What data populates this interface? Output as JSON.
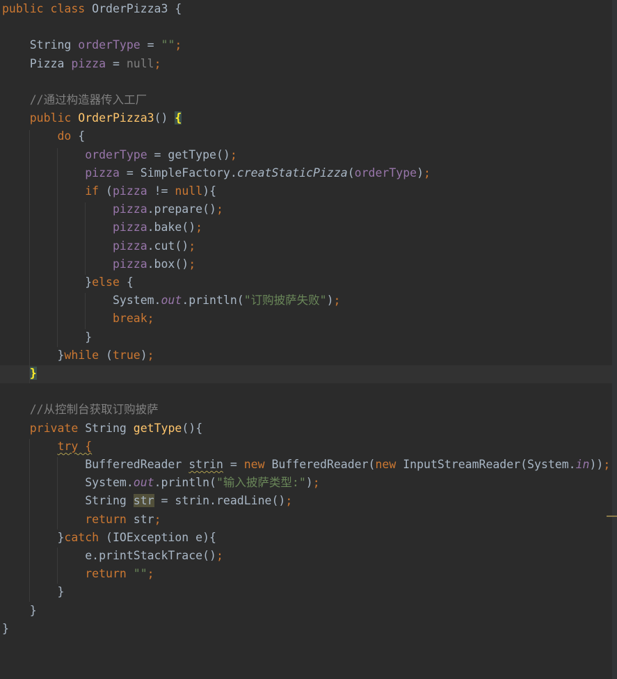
{
  "editor": {
    "language": "java",
    "caret_line": 21,
    "lines": [
      {
        "indent": "",
        "tokens": [
          {
            "t": "public class ",
            "c": "kw"
          },
          {
            "t": "OrderPizza3 {",
            "c": ""
          }
        ]
      },
      {
        "indent": "",
        "tokens": []
      },
      {
        "indent": "    ",
        "tokens": [
          {
            "t": "String ",
            "c": ""
          },
          {
            "t": "orderType",
            "c": "fld"
          },
          {
            "t": " = ",
            "c": ""
          },
          {
            "t": "\"\"",
            "c": "str"
          },
          {
            "t": ";",
            "c": "kw"
          }
        ]
      },
      {
        "indent": "    ",
        "tokens": [
          {
            "t": "Pizza ",
            "c": ""
          },
          {
            "t": "pizza",
            "c": "fld"
          },
          {
            "t": " = ",
            "c": ""
          },
          {
            "t": "null",
            "c": "nul"
          },
          {
            "t": ";",
            "c": "kw"
          }
        ]
      },
      {
        "indent": "",
        "tokens": []
      },
      {
        "indent": "    ",
        "tokens": [
          {
            "t": "//通过构造器传入工厂",
            "c": "cmt"
          }
        ]
      },
      {
        "indent": "    ",
        "tokens": [
          {
            "t": "public ",
            "c": "kw"
          },
          {
            "t": "OrderPizza3",
            "c": "fn"
          },
          {
            "t": "() ",
            "c": ""
          },
          {
            "t": "{",
            "c": "brace-hl"
          }
        ]
      },
      {
        "indent": "        ",
        "tokens": [
          {
            "t": "do ",
            "c": "kw"
          },
          {
            "t": "{",
            "c": ""
          }
        ]
      },
      {
        "indent": "            ",
        "tokens": [
          {
            "t": "orderType",
            "c": "fld"
          },
          {
            "t": " = getType()",
            "c": ""
          },
          {
            "t": ";",
            "c": "kw"
          }
        ]
      },
      {
        "indent": "            ",
        "tokens": [
          {
            "t": "pizza",
            "c": "fld"
          },
          {
            "t": " = SimpleFactory.",
            "c": ""
          },
          {
            "t": "creatStaticPizza",
            "c": "it"
          },
          {
            "t": "(",
            "c": ""
          },
          {
            "t": "orderType",
            "c": "fld"
          },
          {
            "t": ")",
            "c": ""
          },
          {
            "t": ";",
            "c": "kw"
          }
        ]
      },
      {
        "indent": "            ",
        "tokens": [
          {
            "t": "if ",
            "c": "kw"
          },
          {
            "t": "(",
            "c": ""
          },
          {
            "t": "pizza",
            "c": "fld"
          },
          {
            "t": " != ",
            "c": ""
          },
          {
            "t": "null",
            "c": "kw"
          },
          {
            "t": "){",
            "c": ""
          }
        ]
      },
      {
        "indent": "                ",
        "tokens": [
          {
            "t": "pizza",
            "c": "fld"
          },
          {
            "t": ".prepare()",
            "c": ""
          },
          {
            "t": ";",
            "c": "kw"
          }
        ]
      },
      {
        "indent": "                ",
        "tokens": [
          {
            "t": "pizza",
            "c": "fld"
          },
          {
            "t": ".bake()",
            "c": ""
          },
          {
            "t": ";",
            "c": "kw"
          }
        ]
      },
      {
        "indent": "                ",
        "tokens": [
          {
            "t": "pizza",
            "c": "fld"
          },
          {
            "t": ".cut()",
            "c": ""
          },
          {
            "t": ";",
            "c": "kw"
          }
        ]
      },
      {
        "indent": "                ",
        "tokens": [
          {
            "t": "pizza",
            "c": "fld"
          },
          {
            "t": ".box()",
            "c": ""
          },
          {
            "t": ";",
            "c": "kw"
          }
        ]
      },
      {
        "indent": "            ",
        "tokens": [
          {
            "t": "}",
            "c": ""
          },
          {
            "t": "else ",
            "c": "kw"
          },
          {
            "t": "{",
            "c": ""
          }
        ]
      },
      {
        "indent": "                ",
        "tokens": [
          {
            "t": "System.",
            "c": ""
          },
          {
            "t": "out",
            "c": "fld it"
          },
          {
            "t": ".println(",
            "c": ""
          },
          {
            "t": "\"订购披萨失败\"",
            "c": "str"
          },
          {
            "t": ")",
            "c": ""
          },
          {
            "t": ";",
            "c": "kw"
          }
        ]
      },
      {
        "indent": "                ",
        "tokens": [
          {
            "t": "break;",
            "c": "kw"
          }
        ]
      },
      {
        "indent": "            ",
        "tokens": [
          {
            "t": "}",
            "c": ""
          }
        ]
      },
      {
        "indent": "        ",
        "tokens": [
          {
            "t": "}",
            "c": ""
          },
          {
            "t": "while ",
            "c": "kw"
          },
          {
            "t": "(",
            "c": ""
          },
          {
            "t": "true",
            "c": "kw"
          },
          {
            "t": ")",
            "c": ""
          },
          {
            "t": ";",
            "c": "kw"
          }
        ]
      },
      {
        "indent": "    ",
        "tokens": [
          {
            "t": "}",
            "c": "brace-hl"
          }
        ]
      },
      {
        "indent": "",
        "tokens": []
      },
      {
        "indent": "    ",
        "tokens": [
          {
            "t": "//从控制台获取订购披萨",
            "c": "cmt"
          }
        ]
      },
      {
        "indent": "    ",
        "tokens": [
          {
            "t": "private ",
            "c": "kw"
          },
          {
            "t": "String ",
            "c": ""
          },
          {
            "t": "getType",
            "c": "fn"
          },
          {
            "t": "(){",
            "c": ""
          }
        ]
      },
      {
        "indent": "        ",
        "tokens": [
          {
            "t": "try {",
            "c": "kw warn"
          }
        ]
      },
      {
        "indent": "            ",
        "tokens": [
          {
            "t": "BufferedReader ",
            "c": ""
          },
          {
            "t": "strin",
            "c": "warn"
          },
          {
            "t": " = ",
            "c": ""
          },
          {
            "t": "new ",
            "c": "kw"
          },
          {
            "t": "BufferedReader(",
            "c": ""
          },
          {
            "t": "new ",
            "c": "kw"
          },
          {
            "t": "InputStreamReader(System.",
            "c": ""
          },
          {
            "t": "in",
            "c": "fld it"
          },
          {
            "t": "))",
            "c": ""
          },
          {
            "t": ";",
            "c": "kw"
          }
        ]
      },
      {
        "indent": "            ",
        "tokens": [
          {
            "t": "System.",
            "c": ""
          },
          {
            "t": "out",
            "c": "fld it"
          },
          {
            "t": ".println(",
            "c": ""
          },
          {
            "t": "\"输入披萨类型:\"",
            "c": "str"
          },
          {
            "t": ")",
            "c": ""
          },
          {
            "t": ";",
            "c": "kw"
          }
        ]
      },
      {
        "indent": "            ",
        "tokens": [
          {
            "t": "String ",
            "c": ""
          },
          {
            "t": "str",
            "c": "hl-var"
          },
          {
            "t": " = strin.readLine()",
            "c": ""
          },
          {
            "t": ";",
            "c": "kw"
          }
        ]
      },
      {
        "indent": "            ",
        "tokens": [
          {
            "t": "return ",
            "c": "kw"
          },
          {
            "t": "str",
            "c": ""
          },
          {
            "t": ";",
            "c": "kw"
          }
        ]
      },
      {
        "indent": "        ",
        "tokens": [
          {
            "t": "}",
            "c": ""
          },
          {
            "t": "catch ",
            "c": "kw"
          },
          {
            "t": "(IOException e){",
            "c": ""
          }
        ]
      },
      {
        "indent": "            ",
        "tokens": [
          {
            "t": "e.printStackTrace()",
            "c": ""
          },
          {
            "t": ";",
            "c": "kw"
          }
        ]
      },
      {
        "indent": "            ",
        "tokens": [
          {
            "t": "return ",
            "c": "kw"
          },
          {
            "t": "\"\"",
            "c": "str"
          },
          {
            "t": ";",
            "c": "kw"
          }
        ]
      },
      {
        "indent": "        ",
        "tokens": [
          {
            "t": "}",
            "c": ""
          }
        ]
      },
      {
        "indent": "    ",
        "tokens": [
          {
            "t": "}",
            "c": ""
          }
        ]
      },
      {
        "indent": "",
        "tokens": [
          {
            "t": "}",
            "c": ""
          }
        ]
      }
    ]
  }
}
